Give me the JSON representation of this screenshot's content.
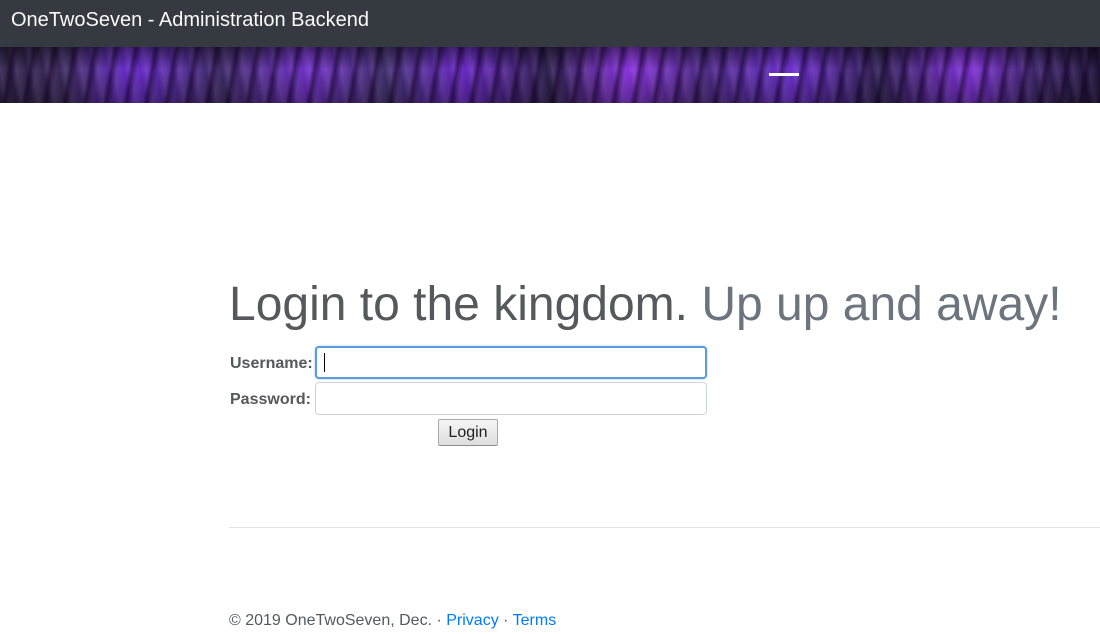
{
  "navbar": {
    "brand": "OneTwoSeven - Administration Backend"
  },
  "headline": {
    "main": "Login to the kingdom.",
    "muted": "Up up and away!"
  },
  "form": {
    "username_label": "Username:",
    "username_value": "",
    "password_label": "Password:",
    "password_value": "",
    "login_label": "Login"
  },
  "footer": {
    "copyright": "© 2019 OneTwoSeven, Dec.",
    "sep1": "·",
    "privacy_label": "Privacy",
    "sep2": "·",
    "terms_label": "Terms"
  },
  "colors": {
    "navbar_bg": "#343a40",
    "link": "#007bff",
    "headline": "#55595c",
    "headline_muted": "#6c757d",
    "focus_border": "#5b9dd9"
  }
}
